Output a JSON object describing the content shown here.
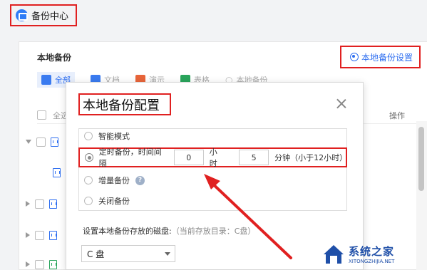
{
  "app": {
    "title": "备份中心"
  },
  "panel": {
    "section_title": "本地备份",
    "settings_link": "本地备份设置",
    "tabs": [
      {
        "label": "全部",
        "icon": "list-icon",
        "color": "#3a7bf0"
      },
      {
        "label": "文档",
        "icon": "doc-icon",
        "color": "#3a7bf0"
      },
      {
        "label": "演示",
        "icon": "ppt-icon",
        "color": "#e8653a"
      },
      {
        "label": "表格",
        "icon": "sheet-icon",
        "color": "#2aa55c"
      },
      {
        "label": "本地备份",
        "icon": "search-icon",
        "color": "#bbb"
      }
    ],
    "header_all": "全选",
    "header_op": "操作"
  },
  "dialog": {
    "title": "本地备份配置",
    "options": {
      "smart": "智能模式",
      "timer_prefix": "定时备份，时间间隔",
      "hours_value": "0",
      "hours_unit": "小时",
      "minutes_value": "5",
      "minutes_unit": "分钟（小于12小时）",
      "incremental": "增量备份",
      "off": "关闭备份"
    },
    "disk_label": "设置本地备份存放的磁盘:",
    "disk_current": "（当前存放目录：C盘）",
    "disk_value": "C 盘"
  },
  "watermark": {
    "main": "系统之家",
    "sub": "XITONGZHIJIA.NET"
  },
  "colors": {
    "accent": "#2f6ff0",
    "highlight": "#e02020"
  }
}
